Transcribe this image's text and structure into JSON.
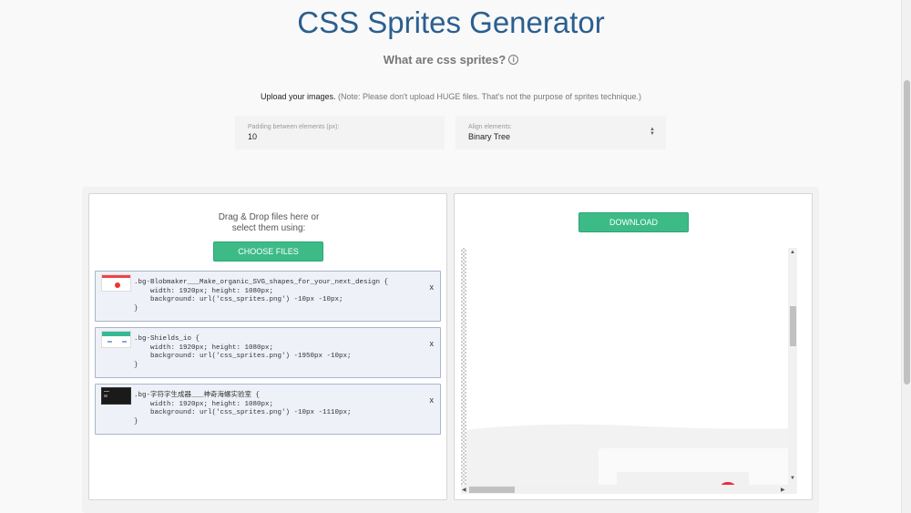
{
  "page": {
    "title": "CSS Sprites Generator",
    "subtitle": "What are css sprites?",
    "info_icon": "i",
    "upload_strong": "Upload your images.",
    "upload_note": " (Note: Please don't upload HUGE files. That's not the purpose of sprites technique.)"
  },
  "options": {
    "padding_label": "Padding between elements (px):",
    "padding_value": "10",
    "align_label": "Align elements:",
    "align_value": "Binary Tree"
  },
  "left": {
    "dnd_line1": "Drag & Drop files here or",
    "dnd_line2": "select them using:",
    "choose_label": "CHOOSE FILES",
    "files": [
      {
        "selector": ".bg-Blobmaker___Make_organic_SVG_shapes_for_your_next_design {",
        "size": "    width: 1920px; height: 1080px;",
        "background": "    background: url('css_sprites.png') -10px -10px;",
        "close": "}",
        "remove": "x"
      },
      {
        "selector": ".bg-Shields_io {",
        "size": "    width: 1920px; height: 1080px;",
        "background": "    background: url('css_sprites.png') -1950px -10px;",
        "close": "}",
        "remove": "x"
      },
      {
        "selector": ".bg-字符字生成器___神奇海螺实验室 {",
        "size": "    width: 1920px; height: 1080px;",
        "background": "    background: url('css_sprites.png') -10px -1110px;",
        "close": "}",
        "remove": "x"
      }
    ]
  },
  "right": {
    "download_label": "DOWNLOAD"
  },
  "colors": {
    "title": "#2b5f8f",
    "accent_green": "#3dbb87",
    "file_bg": "#eef1f8",
    "file_border": "#a9b5cb"
  },
  "icons": {
    "info": "info-circle-icon",
    "select_arrows": "select-arrows-icon",
    "remove": "close-icon"
  }
}
